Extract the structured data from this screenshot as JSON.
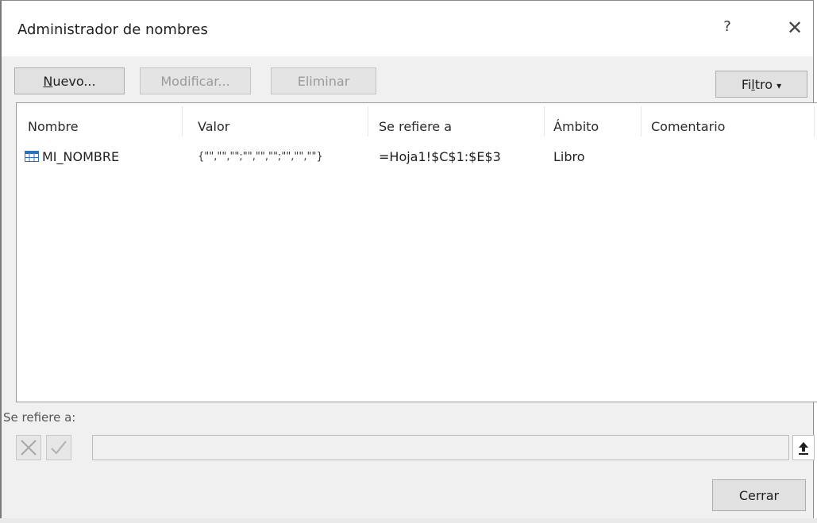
{
  "dialog": {
    "title": "Administrador de nombres",
    "help_label": "?",
    "close_label": "✕"
  },
  "toolbar": {
    "new_label": "Nuevo...",
    "new_underline": "N",
    "new_rest": "uevo...",
    "edit_label": "Modificar...",
    "delete_label": "Eliminar",
    "filter_label": "Filtro",
    "filter_pre": "Fi",
    "filter_underline": "l",
    "filter_post": "tro",
    "filter_arrow": "▾"
  },
  "table": {
    "columns": [
      "Nombre",
      "Valor",
      "Se refiere a",
      "Ámbito",
      "Comentario"
    ],
    "rows": [
      {
        "icon": "named-range-icon",
        "name": "MI_NOMBRE",
        "value": "{\"\",\"\",\"\";\"\",\"\",\"\";\"\",\"\",\"\"}",
        "refers_to": "=Hoja1!$C$1:$E$3",
        "scope": "Libro",
        "comment": ""
      }
    ]
  },
  "refers_section": {
    "label": "Se refiere a:",
    "value": "",
    "cancel_icon": "cancel-x-icon",
    "confirm_icon": "checkmark-icon",
    "collapse_icon": "collapse-arrow-icon"
  },
  "footer": {
    "close_label": "Cerrar"
  }
}
